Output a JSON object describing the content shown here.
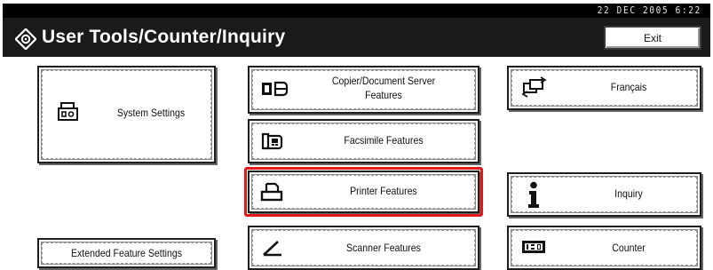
{
  "status_bar": {
    "datetime": "22 DEC  2005  6:22"
  },
  "title_bar": {
    "title": "User Tools/Counter/Inquiry",
    "icon": "user-tools-icon"
  },
  "header": {
    "exit_label": "Exit"
  },
  "left_column": {
    "system_settings": {
      "label": "System Settings",
      "icon": "printer-settings-icon"
    },
    "extended_feature_settings": {
      "label": "Extended Feature Settings"
    }
  },
  "center_column": {
    "copier_document_server": {
      "label_line1": "Copier/Document Server",
      "label_line2": "Features",
      "icon": "copier-icon"
    },
    "facsimile": {
      "label": "Facsimile Features",
      "icon": "fax-icon"
    },
    "printer": {
      "label": "Printer Features",
      "icon": "printer-icon",
      "selected": true
    },
    "scanner": {
      "label": "Scanner Features",
      "icon": "scanner-icon"
    }
  },
  "right_column": {
    "language": {
      "label": "Français",
      "icon": "language-switch-icon"
    },
    "inquiry": {
      "label": "Inquiry",
      "icon": "info-icon"
    },
    "counter": {
      "label": "Counter",
      "icon": "counter-icon"
    }
  },
  "colors": {
    "selection": "#e11919",
    "title_bar": "#1a1a1a",
    "status_bar": "#000000"
  }
}
